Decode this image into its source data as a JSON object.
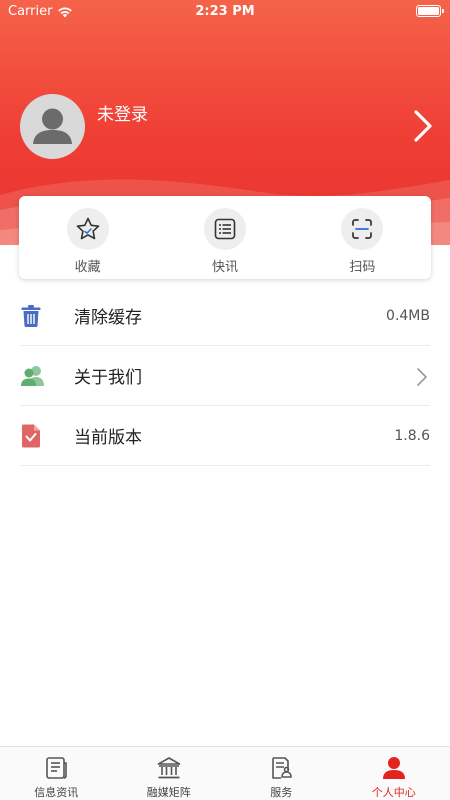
{
  "status_bar": {
    "carrier": "Carrier",
    "time": "2:23 PM"
  },
  "profile": {
    "username": "未登录"
  },
  "quick_actions": [
    {
      "label": "收藏",
      "icon": "star-icon"
    },
    {
      "label": "快讯",
      "icon": "list-icon"
    },
    {
      "label": "扫码",
      "icon": "scan-icon"
    }
  ],
  "settings": {
    "clear_cache": {
      "label": "清除缓存",
      "value": "0.4MB",
      "icon": "trash-icon"
    },
    "about_us": {
      "label": "关于我们",
      "icon": "users-icon"
    },
    "version": {
      "label": "当前版本",
      "value": "1.8.6",
      "icon": "document-check-icon"
    }
  },
  "tabbar": {
    "items": [
      {
        "label": "信息资讯",
        "icon": "news-icon"
      },
      {
        "label": "融媒矩阵",
        "icon": "bank-icon"
      },
      {
        "label": "服务",
        "icon": "service-icon"
      },
      {
        "label": "个人中心",
        "icon": "person-icon"
      }
    ],
    "active_index": 3
  },
  "colors": {
    "brand": "#e8322e",
    "active_tab": "#e5231e"
  }
}
